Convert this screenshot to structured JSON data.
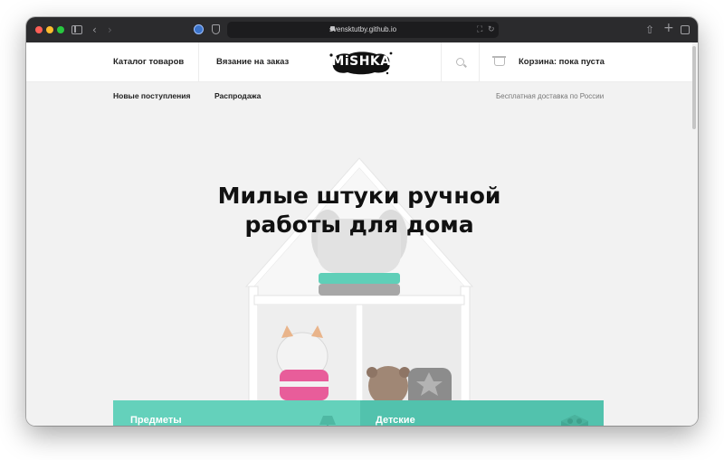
{
  "browser": {
    "url": "svensktutby.github.io"
  },
  "header": {
    "nav_catalog": "Каталог товаров",
    "nav_custom": "Вязание на заказ",
    "logo_text": "MiSHKA",
    "cart_label": "Корзина: пока пуста"
  },
  "subnav": {
    "new_arrivals": "Новые поступления",
    "sale": "Распродажа",
    "shipping": "Бесплатная доставка по России"
  },
  "hero": {
    "title_line1": "Милые штуки ручной",
    "title_line2": "работы для дома"
  },
  "categories": [
    {
      "label": "Предметы\nинтерьера",
      "icon": "lamp-icon",
      "color": "#64d1bb"
    },
    {
      "label": "Детские\nигрушки",
      "icon": "blocks-icon",
      "color": "#52c2ad"
    }
  ],
  "colors": {
    "accent_teal": "#64d1bb",
    "accent_teal_dark": "#52c2ad",
    "titlebar": "#2b2b2d"
  }
}
